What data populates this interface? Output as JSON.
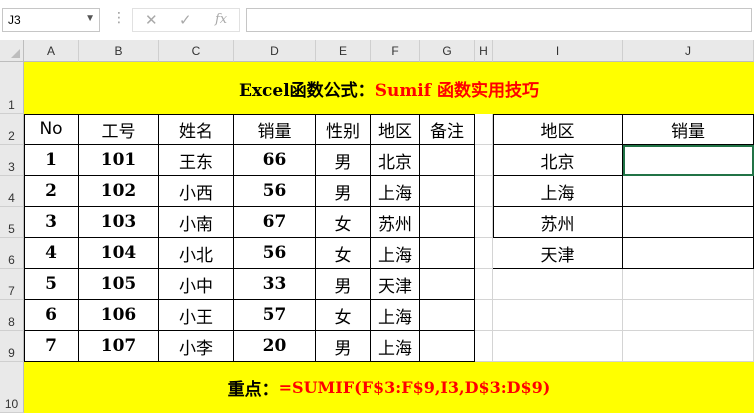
{
  "name_box": "J3",
  "formula_bar": {
    "cancel_icon": "✕",
    "enter_icon": "✓",
    "fx_label": "fx",
    "content": ""
  },
  "columns": [
    "A",
    "B",
    "C",
    "D",
    "E",
    "F",
    "G",
    "H",
    "I",
    "J"
  ],
  "rows": [
    "1",
    "2",
    "3",
    "4",
    "5",
    "6",
    "7",
    "8",
    "9",
    "10"
  ],
  "title": {
    "prefix": "Excel函数公式：",
    "highlight": "Sumif  函数实用技巧"
  },
  "table": {
    "headers": [
      "No",
      "工号",
      "姓名",
      "销量",
      "性别",
      "地区",
      "备注"
    ],
    "rows": [
      [
        "1",
        "101",
        "王东",
        "66",
        "男",
        "北京",
        ""
      ],
      [
        "2",
        "102",
        "小西",
        "56",
        "男",
        "上海",
        ""
      ],
      [
        "3",
        "103",
        "小南",
        "67",
        "女",
        "苏州",
        ""
      ],
      [
        "4",
        "104",
        "小北",
        "56",
        "女",
        "上海",
        ""
      ],
      [
        "5",
        "105",
        "小中",
        "33",
        "男",
        "天津",
        ""
      ],
      [
        "6",
        "106",
        "小王",
        "57",
        "女",
        "上海",
        ""
      ],
      [
        "7",
        "107",
        "小李",
        "20",
        "男",
        "上海",
        ""
      ]
    ]
  },
  "summary": {
    "headers": [
      "地区",
      "销量"
    ],
    "rows": [
      [
        "北京",
        ""
      ],
      [
        "上海",
        ""
      ],
      [
        "苏州",
        ""
      ],
      [
        "天津",
        ""
      ]
    ]
  },
  "footer": {
    "prefix": "重点：",
    "formula": "=SUMIF(F$3:F$9,I3,D$3:D$9)"
  },
  "colors": {
    "banner": "#ffff00",
    "accent": "#ff0000"
  }
}
